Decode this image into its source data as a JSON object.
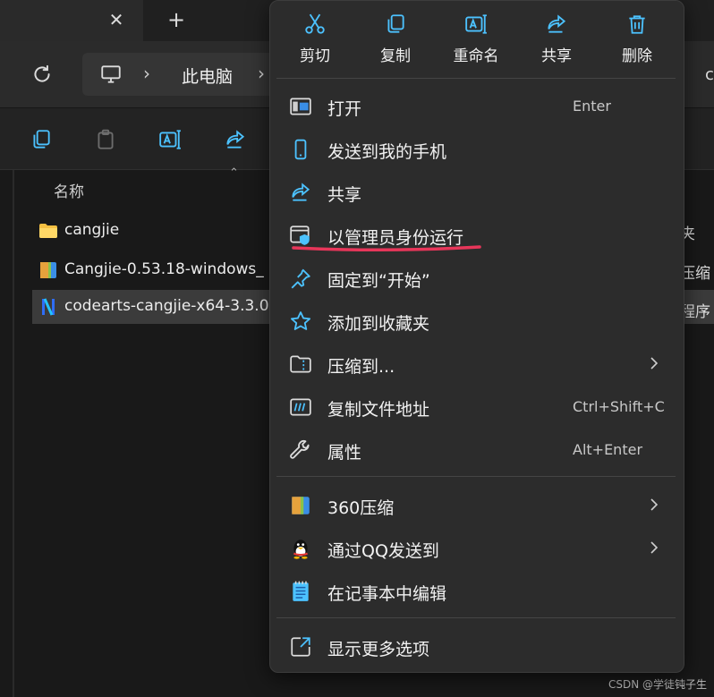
{
  "tab": {
    "close_glyph": "✕",
    "new_glyph": "+"
  },
  "breadcrumb": {
    "separator": "›",
    "this_pc": "此电脑",
    "right_clip": "c"
  },
  "file_list": {
    "column_name": "名称",
    "rows": [
      {
        "name": "cangjie",
        "type": "夹",
        "icon": "folder-icon"
      },
      {
        "name": "Cangjie-0.53.18-windows_",
        "type": "压缩",
        "icon": "archive-icon"
      },
      {
        "name": "codearts-cangjie-x64-3.3.0",
        "type": "程序",
        "icon": "app-icon"
      }
    ]
  },
  "quick_actions": [
    {
      "label": "剪切",
      "icon": "cut-icon"
    },
    {
      "label": "复制",
      "icon": "copy-icon"
    },
    {
      "label": "重命名",
      "icon": "rename-icon"
    },
    {
      "label": "共享",
      "icon": "share-icon"
    },
    {
      "label": "删除",
      "icon": "delete-icon"
    }
  ],
  "menu_items": [
    {
      "label": "打开",
      "shortcut": "Enter",
      "icon": "open-icon"
    },
    {
      "label": "发送到我的手机",
      "shortcut": "",
      "icon": "phone-icon"
    },
    {
      "label": "共享",
      "shortcut": "",
      "icon": "share-icon"
    },
    {
      "label": "以管理员身份运行",
      "shortcut": "",
      "icon": "shield-admin-icon",
      "highlighted": true
    },
    {
      "label": "固定到“开始”",
      "shortcut": "",
      "icon": "pin-icon"
    },
    {
      "label": "添加到收藏夹",
      "shortcut": "",
      "icon": "star-icon"
    },
    {
      "label": "压缩到...",
      "shortcut": "",
      "icon": "zip-folder-icon",
      "submenu": true
    },
    {
      "label": "复制文件地址",
      "shortcut": "Ctrl+Shift+C",
      "icon": "copy-path-icon"
    },
    {
      "label": "属性",
      "shortcut": "Alt+Enter",
      "icon": "wrench-icon"
    },
    {
      "label": "360压缩",
      "shortcut": "",
      "icon": "archive-360-icon",
      "submenu": true
    },
    {
      "label": "通过QQ发送到",
      "shortcut": "",
      "icon": "qq-penguin-icon",
      "submenu": true
    },
    {
      "label": "在记事本中编辑",
      "shortcut": "",
      "icon": "notepad-icon"
    },
    {
      "label": "显示更多选项",
      "shortcut": "",
      "icon": "more-options-icon"
    }
  ],
  "colors": {
    "accent": "#4cc2ff",
    "highlight_underline": "#e8365a",
    "menu_bg": "#2c2c2c"
  },
  "watermark": "CSDN @学徒钝子生"
}
